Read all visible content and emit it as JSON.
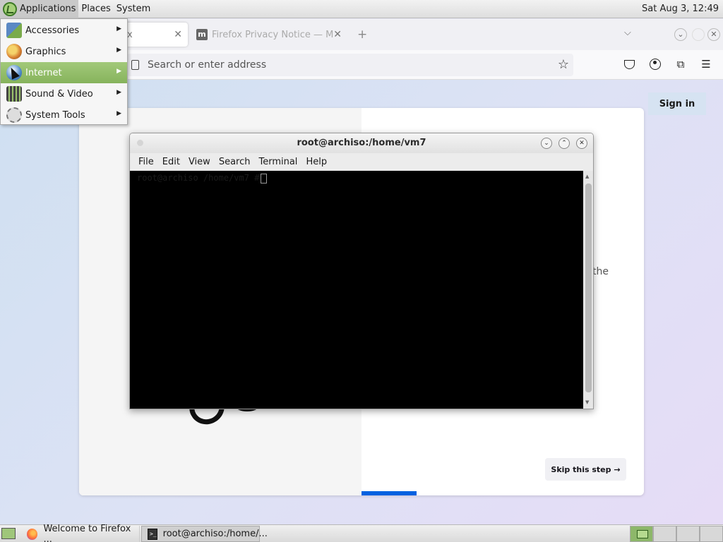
{
  "top_panel": {
    "menus": [
      "Applications",
      "Places",
      "System"
    ],
    "clock": "Sat Aug 3, 12:49"
  },
  "apps_menu": {
    "items": [
      {
        "label": "Accessories",
        "icon": "accessories-icon"
      },
      {
        "label": "Graphics",
        "icon": "graphics-icon"
      },
      {
        "label": "Internet",
        "icon": "internet-globe-icon"
      },
      {
        "label": "Sound & Video",
        "icon": "sound-video-icon"
      },
      {
        "label": "System Tools",
        "icon": "system-tools-icon"
      }
    ],
    "highlighted": "Internet"
  },
  "browser": {
    "tabs": [
      {
        "label": "x",
        "active": true
      },
      {
        "label": "Firefox Privacy Notice — M",
        "favicon": "m",
        "active": false
      }
    ],
    "url_placeholder": "Search or enter address",
    "sign_in": "Sign in",
    "partial_text": "the",
    "skip_label": "Skip this step →"
  },
  "terminal": {
    "title": "root@archiso:/home/vm7",
    "menus": [
      "File",
      "Edit",
      "View",
      "Search",
      "Terminal",
      "Help"
    ],
    "prompt": "root@archiso /home/vm7 #"
  },
  "taskbar": {
    "tasks": [
      {
        "label": "Welcome to Firefox ...",
        "icon": "firefox-icon"
      },
      {
        "label": "root@archiso:/home/...",
        "icon": "terminal-icon"
      }
    ]
  },
  "colors": {
    "menu_highlight": "#8fbb64",
    "firefox_blue": "#0061e0",
    "terminal_bg": "#000000"
  }
}
